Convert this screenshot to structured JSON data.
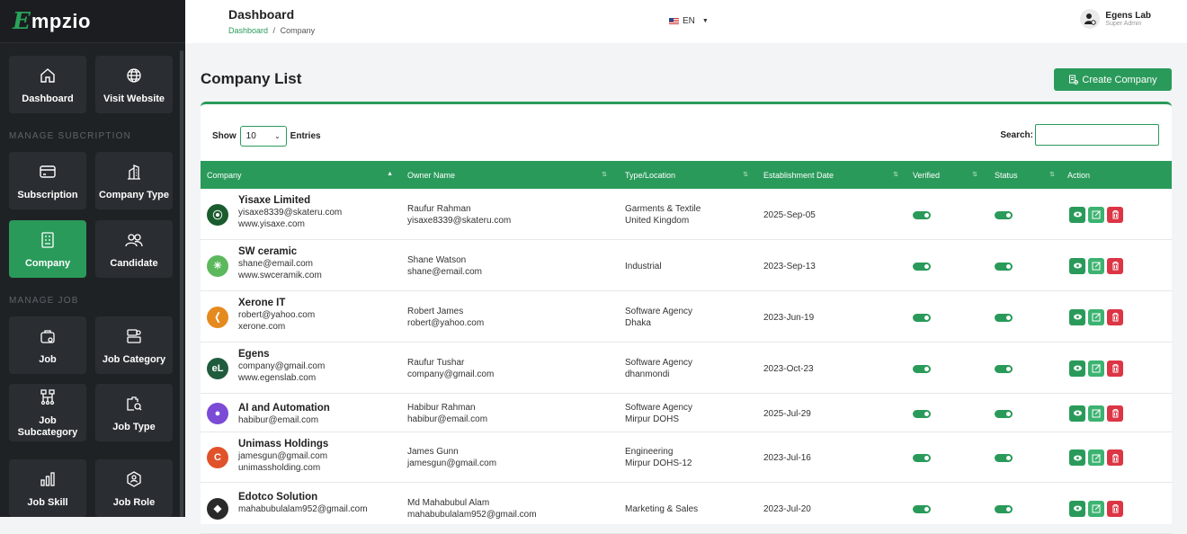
{
  "brand": {
    "letter": "E",
    "rest": "mpzio"
  },
  "sidebar": {
    "sections": [
      "MANAGE SUBCRIPTION",
      "MANAGE JOB"
    ],
    "items": [
      {
        "label": "Dashboard",
        "icon": "home-icon"
      },
      {
        "label": "Visit Website",
        "icon": "globe-icon"
      },
      {
        "label": "Subscription",
        "icon": "card-icon"
      },
      {
        "label": "Company Type",
        "icon": "building-icon"
      },
      {
        "label": "Company",
        "icon": "company-icon",
        "active": true
      },
      {
        "label": "Candidate",
        "icon": "users-icon"
      },
      {
        "label": "Job",
        "icon": "briefcase-icon"
      },
      {
        "label": "Job Category",
        "icon": "category-icon"
      },
      {
        "label": "Job Subcategory",
        "icon": "hierarchy-icon"
      },
      {
        "label": "Job Type",
        "icon": "job-search-icon"
      },
      {
        "label": "Job Skill",
        "icon": "chart-icon"
      },
      {
        "label": "Job Role",
        "icon": "role-icon"
      }
    ]
  },
  "topbar": {
    "title": "Dashboard",
    "crumb_link": "Dashboard",
    "crumb_sep": "/",
    "crumb_current": "Company",
    "language": "EN",
    "user_name": "Egens Lab",
    "user_role": "Super Admin"
  },
  "main": {
    "title": "Company List",
    "create_label": "Create Company",
    "show_label": "Show",
    "entries_value": "10",
    "entries_label": "Entries",
    "search_label": "Search:"
  },
  "table": {
    "headers": [
      "Company",
      "Owner Name",
      "Type/Location",
      "Establishment Date",
      "Verified",
      "Status",
      "Action"
    ],
    "rows": [
      {
        "name": "Yisaxe Limited",
        "email": "yisaxe8339@skateru.com",
        "web": "www.yisaxe.com",
        "owner": "Raufur Rahman",
        "owner_email": "yisaxe8339@skateru.com",
        "type": "Garments & Textile",
        "location": "United Kingdom",
        "date": "2025-Sep-05",
        "logo_color": "#1a5c2e",
        "logo_text": "⦿"
      },
      {
        "name": "SW ceramic",
        "email": "shane@email.com",
        "web": "www.swceramik.com",
        "owner": "Shane Watson",
        "owner_email": "shane@email.com",
        "type": "Industrial",
        "location": "",
        "date": "2023-Sep-13",
        "logo_color": "#5cb85c",
        "logo_text": "✳"
      },
      {
        "name": "Xerone IT",
        "email": "robert@yahoo.com",
        "web": "xerone.com",
        "owner": "Robert James",
        "owner_email": "robert@yahoo.com",
        "type": "Software Agency",
        "location": "Dhaka",
        "date": "2023-Jun-19",
        "logo_color": "#e58a1f",
        "logo_text": "❬"
      },
      {
        "name": "Egens",
        "email": "company@gmail.com",
        "web": "www.egenslab.com",
        "owner": "Raufur Tushar",
        "owner_email": "company@gmail.com",
        "type": "Software Agency",
        "location": "dhanmondi",
        "date": "2023-Oct-23",
        "logo_color": "#1f5c3e",
        "logo_text": "eL"
      },
      {
        "name": "AI and Automation",
        "email": "habibur@email.com",
        "web": "",
        "owner": "Habibur Rahman",
        "owner_email": "habibur@email.com",
        "type": "Software Agency",
        "location": "Mirpur DOHS",
        "date": "2025-Jul-29",
        "logo_color": "#7b4bd6",
        "logo_text": "●"
      },
      {
        "name": "Unimass Holdings",
        "email": "jamesgun@gmail.com",
        "web": "unimassholding.com",
        "owner": "James Gunn",
        "owner_email": "jamesgun@gmail.com",
        "type": "Engineering",
        "location": "Mirpur DOHS-12",
        "date": "2023-Jul-16",
        "logo_color": "#e0522a",
        "logo_text": "C"
      },
      {
        "name": "Edotco Solution",
        "email": "mahabubulalam952@gmail.com",
        "web": "",
        "owner": "Md Mahabubul Alam",
        "owner_email": "mahabubulalam952@gmail.com",
        "type": "Marketing & Sales",
        "location": "",
        "date": "2023-Jul-20",
        "logo_color": "#2a2a2a",
        "logo_text": "◆"
      }
    ]
  },
  "colors": {
    "accent": "#2a9a5a",
    "danger": "#dc3545",
    "sidebar": "#1f2225"
  }
}
